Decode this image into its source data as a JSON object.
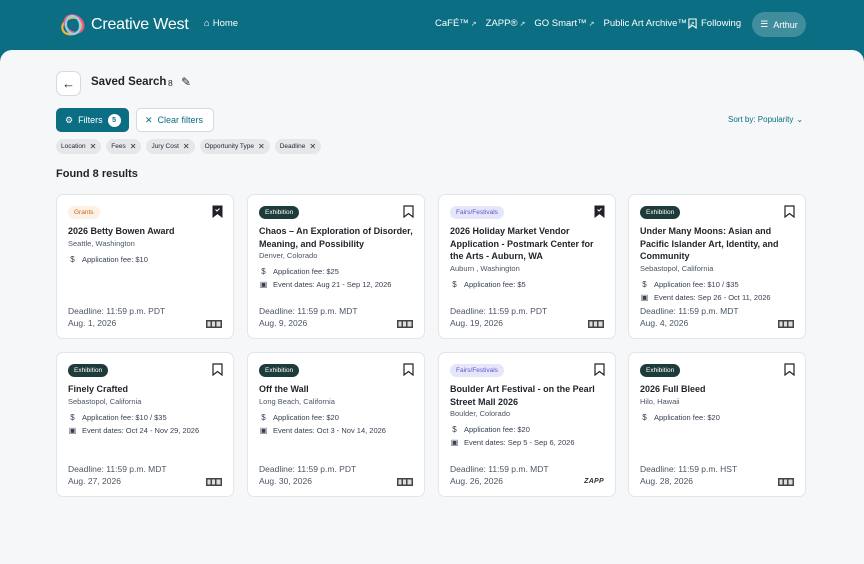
{
  "header": {
    "brand": "Creative West",
    "home": "Home",
    "nav_links": [
      "CaFÉ™",
      "ZAPP®",
      "GO Smart™",
      "Public Art Archive™"
    ],
    "following": "Following",
    "user": "Arthur",
    "colors": {
      "primary": "#0b6e83"
    }
  },
  "page": {
    "title": "Saved Search",
    "count": "8",
    "filters_label": "Filters",
    "filters_count": "5",
    "clear_label": "Clear filters",
    "sort_label": "Sort by: Popularity",
    "chips": [
      "Location",
      "Fees",
      "Jury Cost",
      "Opportunity Type",
      "Deadline"
    ],
    "found": "Found 8 results"
  },
  "cards": [
    {
      "category": "Grants",
      "title": "2026 Betty Bowen Award",
      "location": "Seattle, Washington",
      "fee": "Application fee: $10",
      "event": "",
      "deadline": "Deadline: 11:59 p.m. PDT",
      "date": "Aug. 1, 2026",
      "saved": true,
      "source": "cafe-logo"
    },
    {
      "category": "Exhibition",
      "title": "Chaos – An Exploration of Disorder, Meaning, and Possibility",
      "location": "Denver, Colorado",
      "fee": "Application fee: $25",
      "event": "Event dates: Aug 21 - Sep 12, 2026",
      "deadline": "Deadline: 11:59 p.m. MDT",
      "date": "Aug. 9, 2026",
      "saved": false,
      "source": "cafe-logo"
    },
    {
      "category": "Fairs/Festivals",
      "title": "2026 Holiday Market Vendor Application - Postmark Center for the Arts - Auburn, WA",
      "location": "Auburn , Washington",
      "fee": "Application fee: $5",
      "event": "",
      "deadline": "Deadline: 11:59 p.m. PDT",
      "date": "Aug. 19, 2026",
      "saved": true,
      "source": "cafe-logo"
    },
    {
      "category": "Exhibition",
      "title": "Under Many Moons: Asian and Pacific Islander Art, Identity, and Community",
      "location": "Sebastopol, California",
      "fee": "Application fee: $10 / $35",
      "event": "Event dates: Sep 26 - Oct 11, 2026",
      "deadline": "Deadline: 11:59 p.m. MDT",
      "date": "Aug. 4, 2026",
      "saved": false,
      "source": "cafe-logo"
    },
    {
      "category": "Exhibition",
      "title": "Finely Crafted",
      "location": "Sebastopol, California",
      "fee": "Application fee: $10 / $35",
      "event": "Event dates: Oct 24 - Nov 29, 2026",
      "deadline": "Deadline: 11:59 p.m. MDT",
      "date": "Aug. 27, 2026",
      "saved": false,
      "source": "cafe-logo"
    },
    {
      "category": "Exhibition",
      "title": "Off the Wall",
      "location": "Long Beach, California",
      "fee": "Application fee: $20",
      "event": "Event dates: Oct 3 - Nov 14, 2026",
      "deadline": "Deadline: 11:59 p.m. PDT",
      "date": "Aug. 30, 2026",
      "saved": false,
      "source": "cafe-logo"
    },
    {
      "category": "Fairs/Festivals",
      "title": "Boulder Art Festival - on the Pearl Street Mall 2026",
      "location": "Boulder, Colorado",
      "fee": "Application fee: $20",
      "event": "Event dates: Sep 5 - Sep 6, 2026",
      "deadline": "Deadline: 11:59 p.m. MDT",
      "date": "Aug. 26, 2026",
      "saved": false,
      "source": "ZAPP"
    },
    {
      "category": "Exhibition",
      "title": "2026 Full Bleed",
      "location": "Hilo, Hawaii",
      "fee": "Application fee: $20",
      "event": "",
      "deadline": "Deadline: 11:59 p.m. HST",
      "date": "Aug. 28, 2026",
      "saved": false,
      "source": "cafe-logo"
    }
  ]
}
